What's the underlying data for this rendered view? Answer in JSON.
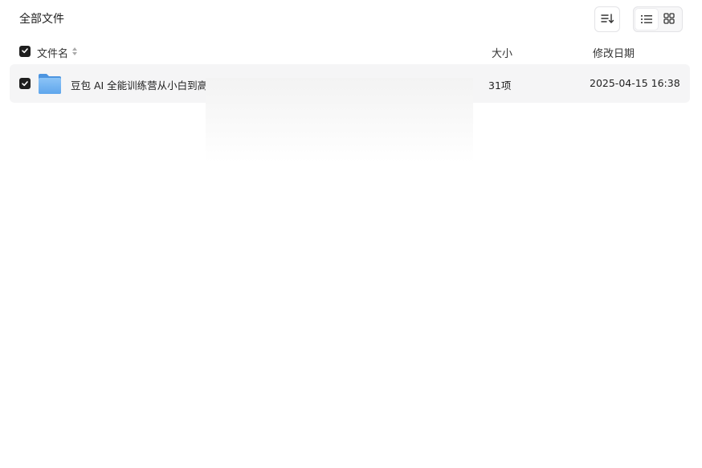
{
  "breadcrumb": {
    "label": "全部文件"
  },
  "toolbar": {
    "sort_icon": "sort-icon",
    "view_options": [
      {
        "icon": "list-view-icon",
        "active": true
      },
      {
        "icon": "grid-view-icon",
        "active": false
      }
    ]
  },
  "table": {
    "headers": {
      "name": "文件名",
      "size": "大小",
      "date": "修改日期"
    },
    "rows": [
      {
        "icon": "folder-icon",
        "name": "豆包 AI 全能训练营从小白到高手",
        "size": "31项",
        "date": "2025-04-15 16:38",
        "checked": true
      }
    ]
  },
  "colors": {
    "checkbox": "#1f1f1f",
    "row_bg": "#f5f5f6",
    "folder": "#6aaef0"
  }
}
